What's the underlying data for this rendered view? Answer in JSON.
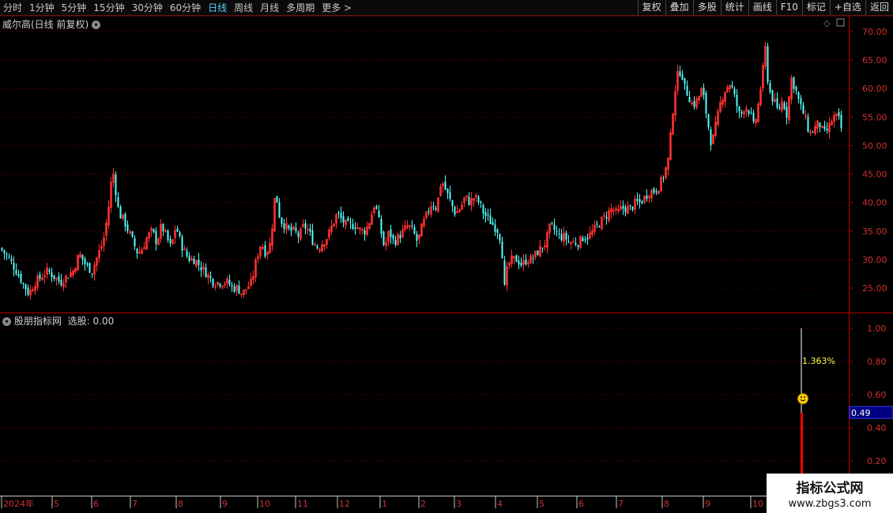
{
  "toolbar": {
    "periods": [
      "分时",
      "1分钟",
      "5分钟",
      "15分钟",
      "30分钟",
      "60分钟",
      "日线",
      "周线",
      "月线",
      "多周期",
      "更多 >"
    ],
    "active_period": "日线",
    "actions": [
      "复权",
      "叠加",
      "多股",
      "统计",
      "画线",
      "F10",
      "标记",
      "+自选",
      "返回"
    ]
  },
  "main_panel": {
    "title": "威尔高(日线 前复权)",
    "y_ticks": [
      "70.00",
      "65.00",
      "60.00",
      "55.00",
      "50.00",
      "45.00",
      "40.00",
      "35.00",
      "30.00",
      "25.00"
    ]
  },
  "indicator_panel": {
    "title": "股朋指标网",
    "signal_label": "选股: 0.00",
    "y_ticks": [
      "1.00",
      "0.80",
      "0.60",
      "0.40",
      "0.20"
    ],
    "current_value": "0.49",
    "annotation": "1.363%"
  },
  "x_axis": {
    "labels": [
      "2024年",
      "5",
      "6",
      "7",
      "8",
      "9",
      "10",
      "11",
      "12",
      "1",
      "2",
      "3",
      "4",
      "5",
      "6",
      "7",
      "8",
      "9",
      "10"
    ]
  },
  "watermark": {
    "line1": "指标公式网",
    "line2": "www.zbgs3.com"
  },
  "colors": {
    "up": "#ff3030",
    "down": "#54ffff",
    "grid": "#7a0000",
    "axis": "#b00000"
  },
  "chart_data": {
    "type": "candlestick",
    "title": "威尔高(日线 前复权)",
    "ylim": [
      22,
      72
    ],
    "x_labels": [
      "2024年",
      "5",
      "6",
      "7",
      "8",
      "9",
      "10",
      "11",
      "12",
      "1",
      "2",
      "3",
      "4",
      "5",
      "6",
      "7",
      "8",
      "9",
      "10"
    ],
    "close_path": [
      [
        0,
        32
      ],
      [
        6,
        31
      ],
      [
        12,
        30
      ],
      [
        20,
        28
      ],
      [
        28,
        26
      ],
      [
        36,
        24
      ],
      [
        44,
        26
      ],
      [
        52,
        27
      ],
      [
        60,
        28
      ],
      [
        68,
        27
      ],
      [
        76,
        26
      ],
      [
        84,
        27
      ],
      [
        92,
        28
      ],
      [
        100,
        31
      ],
      [
        108,
        29
      ],
      [
        116,
        28
      ],
      [
        124,
        31
      ],
      [
        130,
        33
      ],
      [
        136,
        38
      ],
      [
        142,
        46
      ],
      [
        146,
        42
      ],
      [
        150,
        38
      ],
      [
        156,
        37
      ],
      [
        162,
        35
      ],
      [
        168,
        33
      ],
      [
        174,
        31
      ],
      [
        180,
        32
      ],
      [
        186,
        34
      ],
      [
        192,
        35
      ],
      [
        198,
        33
      ],
      [
        204,
        36
      ],
      [
        210,
        34
      ],
      [
        216,
        32
      ],
      [
        222,
        36
      ],
      [
        228,
        33
      ],
      [
        234,
        31
      ],
      [
        240,
        30
      ],
      [
        246,
        30
      ],
      [
        252,
        29
      ],
      [
        258,
        28
      ],
      [
        264,
        27
      ],
      [
        270,
        26
      ],
      [
        276,
        26
      ],
      [
        282,
        26
      ],
      [
        288,
        26
      ],
      [
        294,
        25
      ],
      [
        300,
        25
      ],
      [
        306,
        24
      ],
      [
        312,
        25
      ],
      [
        318,
        26
      ],
      [
        324,
        30
      ],
      [
        330,
        33
      ],
      [
        336,
        31
      ],
      [
        342,
        33
      ],
      [
        348,
        42
      ],
      [
        354,
        37
      ],
      [
        360,
        36
      ],
      [
        366,
        35
      ],
      [
        372,
        35
      ],
      [
        378,
        34
      ],
      [
        384,
        36
      ],
      [
        390,
        35
      ],
      [
        396,
        33
      ],
      [
        402,
        32
      ],
      [
        408,
        33
      ],
      [
        414,
        34
      ],
      [
        420,
        36
      ],
      [
        426,
        38
      ],
      [
        432,
        37
      ],
      [
        438,
        36
      ],
      [
        444,
        36
      ],
      [
        450,
        36
      ],
      [
        456,
        35
      ],
      [
        462,
        35
      ],
      [
        468,
        37
      ],
      [
        474,
        40
      ],
      [
        480,
        36
      ],
      [
        486,
        32
      ],
      [
        492,
        35
      ],
      [
        498,
        33
      ],
      [
        504,
        34
      ],
      [
        510,
        35
      ],
      [
        516,
        36
      ],
      [
        522,
        35
      ],
      [
        528,
        33
      ],
      [
        534,
        36
      ],
      [
        540,
        38
      ],
      [
        546,
        40
      ],
      [
        552,
        39
      ],
      [
        558,
        44
      ],
      [
        564,
        42
      ],
      [
        570,
        40
      ],
      [
        576,
        38
      ],
      [
        582,
        39
      ],
      [
        588,
        41
      ],
      [
        594,
        40
      ],
      [
        600,
        41
      ],
      [
        606,
        40
      ],
      [
        612,
        38
      ],
      [
        618,
        37
      ],
      [
        624,
        36
      ],
      [
        630,
        35
      ],
      [
        634,
        33
      ],
      [
        638,
        25
      ],
      [
        642,
        29
      ],
      [
        648,
        30
      ],
      [
        654,
        30
      ],
      [
        660,
        29
      ],
      [
        666,
        30
      ],
      [
        672,
        30
      ],
      [
        678,
        31
      ],
      [
        684,
        32
      ],
      [
        690,
        33
      ],
      [
        696,
        36
      ],
      [
        702,
        35
      ],
      [
        708,
        34
      ],
      [
        714,
        34
      ],
      [
        720,
        33
      ],
      [
        726,
        33
      ],
      [
        732,
        33
      ],
      [
        738,
        34
      ],
      [
        744,
        34
      ],
      [
        750,
        35
      ],
      [
        756,
        36
      ],
      [
        762,
        37
      ],
      [
        768,
        38
      ],
      [
        774,
        39
      ],
      [
        780,
        38
      ],
      [
        786,
        39
      ],
      [
        792,
        39
      ],
      [
        798,
        39
      ],
      [
        804,
        40
      ],
      [
        810,
        40
      ],
      [
        816,
        41
      ],
      [
        822,
        42
      ],
      [
        828,
        42
      ],
      [
        834,
        43
      ],
      [
        840,
        45
      ],
      [
        846,
        48
      ],
      [
        850,
        55
      ],
      [
        854,
        60
      ],
      [
        858,
        63
      ],
      [
        862,
        63
      ],
      [
        866,
        60
      ],
      [
        870,
        59
      ],
      [
        876,
        57
      ],
      [
        882,
        58
      ],
      [
        888,
        60
      ],
      [
        894,
        55
      ],
      [
        900,
        50
      ],
      [
        906,
        54
      ],
      [
        912,
        58
      ],
      [
        918,
        60
      ],
      [
        924,
        61
      ],
      [
        930,
        58
      ],
      [
        936,
        55
      ],
      [
        942,
        57
      ],
      [
        948,
        56
      ],
      [
        954,
        53
      ],
      [
        960,
        58
      ],
      [
        964,
        62
      ],
      [
        968,
        67
      ],
      [
        972,
        60
      ],
      [
        978,
        58
      ],
      [
        984,
        56
      ],
      [
        990,
        58
      ],
      [
        996,
        55
      ],
      [
        1000,
        62
      ],
      [
        1006,
        60
      ],
      [
        1012,
        57
      ],
      [
        1018,
        55
      ],
      [
        1024,
        52
      ],
      [
        1030,
        53
      ],
      [
        1036,
        54
      ],
      [
        1042,
        52
      ],
      [
        1048,
        53
      ],
      [
        1054,
        55
      ],
      [
        1060,
        55
      ],
      [
        1064,
        53
      ],
      [
        1068,
        52
      ]
    ],
    "indicator_series": {
      "spike_x": 1014,
      "peak": 1.0,
      "current": 0.49
    }
  }
}
